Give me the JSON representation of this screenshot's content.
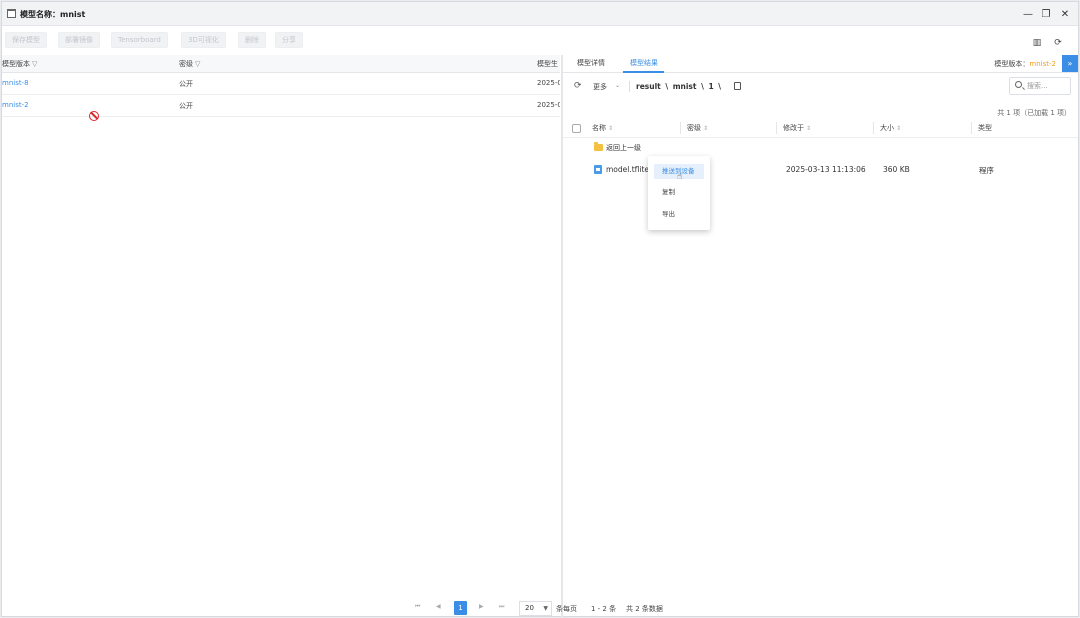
{
  "window": {
    "title": "模型名称：mnist"
  },
  "toolbar": {
    "buttons": [
      "保存模型",
      "部署镜像",
      "Tensorboard",
      "3D可视化",
      "删除",
      "分享"
    ]
  },
  "left_table": {
    "headers": [
      "模型版本",
      "密级",
      "模型生"
    ],
    "rows": [
      {
        "version": "mnist-8",
        "level": "公开",
        "date": "2025-0"
      },
      {
        "version": "mnist-2",
        "level": "公开",
        "date": "2025-0"
      }
    ]
  },
  "right": {
    "tabs": [
      "模型详情",
      "模型结果"
    ],
    "version_label": "模型版本：",
    "version_value": "mnist-2",
    "more_label": "更多",
    "path": "result \\ mnist \\ 1 \\",
    "search_placeholder": "搜索...",
    "total": "共 1 项（已加载 1 项）",
    "headers": [
      "名称",
      "密级",
      "修改于",
      "大小",
      "类型"
    ],
    "back_label": "返回上一级",
    "file": {
      "name": "model.tflite",
      "modified": "2025-03-13 11:13:06",
      "size": "360 KB",
      "type": "程序"
    }
  },
  "context_menu": {
    "items": [
      "推送到设备",
      "复制",
      "导出"
    ]
  },
  "pager": {
    "current_page": "1",
    "page_size": "20",
    "per_page_label": "条每页",
    "range": "1 - 2 条",
    "total": "共 2 条数据"
  },
  "colors": {
    "accent": "#3a8ee6",
    "version": "#f0a020",
    "forbidden": "#d9262c"
  }
}
